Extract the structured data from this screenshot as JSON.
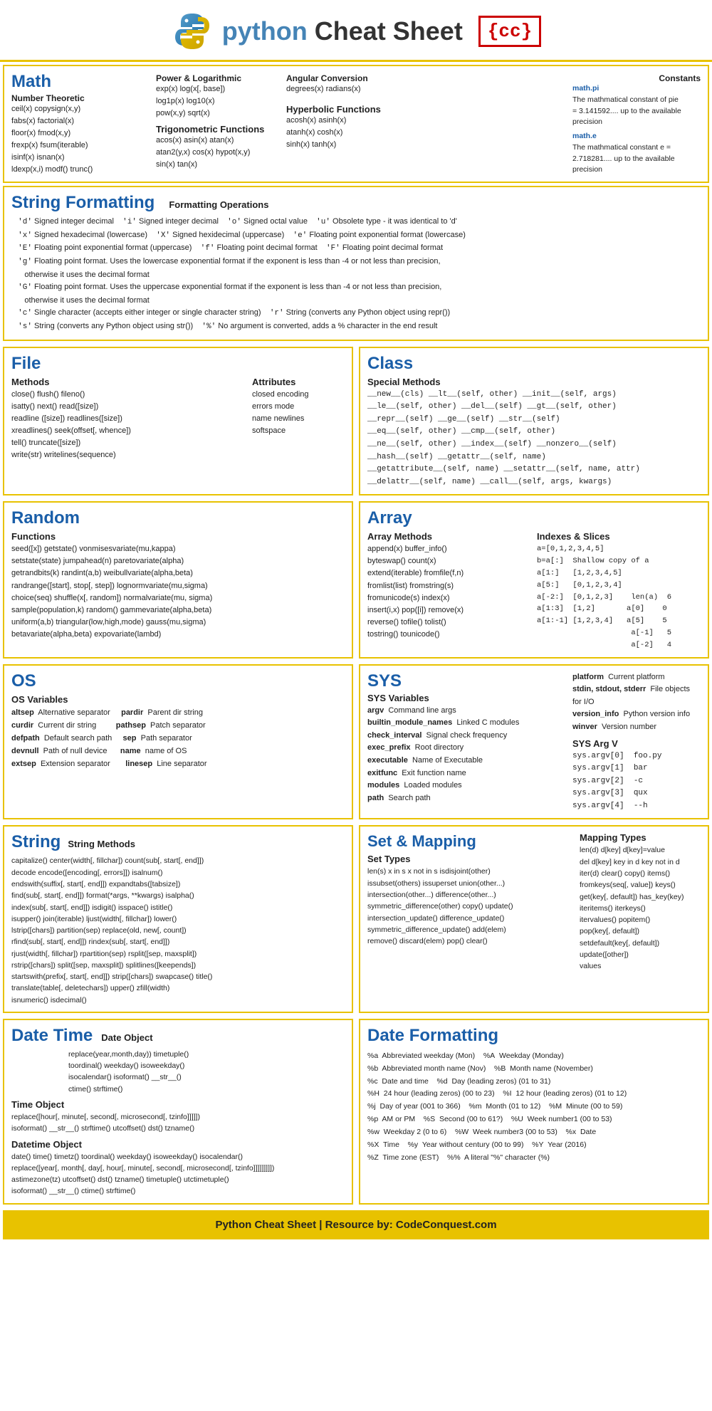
{
  "header": {
    "title": "python Cheat Sheet",
    "python_part": "python",
    "cc_logo": "{cc}"
  },
  "math": {
    "title": "Math",
    "number_theoretic_title": "Number Theoretic",
    "number_theoretic": "ceil(x)  copysign(x,y)\nfabs(x)  factorial(x)\nfloor(x)  fmod(x,y)\nfrexp(x)  fsum(iterable)\nisinf(x)  isnan(x)\nldexp(x,i)  modf()  trunc()",
    "power_log_title": "Power & Logarithmic",
    "power_log": "exp(x)  log(x[, base])\nlog1p(x)  log10(x)\npow(x,y)  sqrt(x)",
    "trig_title": "Trigonometric Functions",
    "trig": "acos(x)  asin(x)  atan(x)\natan2(y,x)  cos(x)  hypot(x,y)\nsin(x)  tan(x)",
    "angular_title": "Angular Conversion",
    "angular": "degrees(x)  radians(x)",
    "hyperbolic_title": "Hyperbolic Functions",
    "hyperbolic": "acosh(x)  asinh(x)\natanh(x)  cosh(x)\nsinh(x)  tanh(x)",
    "constants_title": "Constants",
    "constants": "math.pi\nThe mathmatical constant of pie\n= 3.141592.... up to the available\nprecision\nmath.e\nThe mathmatical constant e =\n2.718281.... up to the available\nprecision"
  },
  "string_formatting": {
    "title": "String Formatting",
    "ops_title": "Formatting Operations",
    "lines": [
      "'d' Signed integer decimal    'i' Signed integer decimal    'o' Signed octal value    'u' Obsolete type - it was identical to 'd'",
      "'x' Signed hexadecimal (lowercase)    'X' Signed hexidecimal (uppercase)    'e' Floating point exponential format (lowercase)",
      "'E' Floating point exponential format (uppercase)    'f' Floating point decimal format    'F' Floating point decimal format",
      "'g' Floating point format. Uses the lowercase exponential format if the exponent is less than -4 or not less than precision, otherwise it uses the decimal format",
      "'G' Floating point format. Uses the uppercase exponential format if the exponent is less than -4 or not less than precision, otherwise it uses the decimal format",
      "'c' Single character (accepts either integer or single character string)    'r' String (converts any Python object using repr())",
      "'s' String (converts any Python object using str())    '%' No argument is converted, adds a % character in the end result"
    ]
  },
  "file": {
    "title": "File",
    "methods_title": "Methods",
    "methods": "close()  flush()  fileno()\nisatty()  next()  read([size])\nreadline ([size])  readlines([size])\nxreadlines()  seek(offset[, whence])\ntell()  truncate([size])\nwrite(str)  writelines(sequence)",
    "attributes_title": "Attributes",
    "attributes": "closed  encoding\nerrors  mode\nname  newlines\nsoftspace"
  },
  "class": {
    "title": "Class",
    "special_methods_title": "Special Methods",
    "special_methods": "__new__(cls)  __lt__(self, other)  __init__(self, args)\n__le__(self, other)  __del__(self)  __gt__(self, other)\n__repr__(self)  __ge__(self)  __str__(self)\n__eq__(self, other)  __cmp__(self, other)\n__ne__(self, other)  __index__(self)  __nonzero__(self)\n__hash__(self)  __getattr__(self, name)\n__getattribute__(self, name)  __setattr__(self, name, attr)\n__delattr__(self, name)  __call__(self, args, kwargs)"
  },
  "random": {
    "title": "Random",
    "functions_title": "Functions",
    "functions": "seed([x])  getstate()  vonmisesvariate(mu,kappa)\nsetstate(state)  jumpahead(n)  paretovariate(alpha)\ngetrandbits(k)  randint(a,b)  weibullvariate(alpha,beta)\nrandrange([start], stop[, step])  lognormvariate(mu,sigma)\nchoice(seq)  shuffle(x[, random])  normalvariate(mu, sigma)\nsample(population,k)  random()  gammevariate(alpha,beta)\nuniform(a,b)  triangular(low,high,mode)  gauss(mu,sigma)\nbetavariate(alpha,beta)  expovariate(lambd)"
  },
  "array": {
    "title": "Array",
    "methods_title": "Array Methods",
    "methods": "append(x)  buffer_info()\nbyteswap()  count(x)\nextend(iterable)  fromfile(f,n)\nfromlist(list)  fromstring(s)\nfromunicode(s)  index(x)\ninsert(i,x)  pop([i])  remove(x)\nreverse()  tofile()  tolist()\ntostring()  tounicode()",
    "indexes_title": "Indexes & Slices",
    "indexes": "a=[0,1,2,3,4,5]\nb=a[:]  Shallow copy of a\na[1:]   [1,2,3,4,5]\na[5:]   [0,1,2,3,4]\na[-2:]  [0,1,2,3]    len(a)  6\na[1:3]  [1,2]        a[0]    0\na[1:-1] [1,2,3,4]    a[5]    5\n                     a[-1]   5\n                     a[-2]   4"
  },
  "os": {
    "title": "OS",
    "variables_title": "OS Variables",
    "variables": "altsep  Alternative separator    pardir  Parent dir string\ncurdir  Current dir string        pathsep  Patch separator\ndefpath  Default search path      sep  Path separator\ndevnull  Path of null device      name  name of OS\nextsep  Extension separator       linesep  Line separator"
  },
  "sys": {
    "title": "SYS",
    "platform": "platform  Current platform\nstdin, stdout, stderr  File objects for I/O\nversion_info  Python version info\nwinver  Version number",
    "variables_title": "SYS Variables",
    "variables": "argv  Command line args\nbuiltin_module_names  Linked C modules\ncheck_interval  Signal check frequency\nexec_prefix  Root directory\nexecutable  Name of Executable\nexitfunc  Exit function name\nmodules  Loaded modules\npath  Search path",
    "arg_v_title": "SYS Arg V",
    "arg_v": "sys.argv[0]  foo.py\nsys.argv[1]  bar\nsys.argv[2]  -c\nsys.argv[3]  qux\nsys.argv[4]  --h"
  },
  "string": {
    "title": "String",
    "methods_title": "String Methods",
    "methods": "capitalize()  center(width[, fillchar])  count(sub[, start[, end]])\ndecode  encode([encoding[, errors]])  isalnum()\nendswith(suffix[, start[, end]])  expandtabs([tabsize])\nfind(sub[, start[, end]])  format(*args, **kwargs)  isalpha()\nindex(sub[, start[, end]])  isdigit()  isspace()  istitle()\nisupper()  join(iterable)  ljust(width[, fillchar])  lower()\nlstrip([chars])  partition(sep)  replace(old, new[, count])\nrfind(sub[, start[, end]])  rindex(sub[, start[, end]])\nrjust(width[, fillchar])  rpartition(sep)  rsplit([sep, maxsplit])\nrstrip([chars])  split([sep, maxsplit])  splitlines([keepends])\nstartswith(prefix[, start[, end]])  strip([chars])  swapcase()  title()\ntranslate(table[, deletechars])  upper()  zfill(width)\nisnumeric()  isdecimal()"
  },
  "set_mapping": {
    "title": "Set & Mapping",
    "mapping_title": "Mapping Types",
    "mapping": "len(d)  d[key]  d[key]=value\ndel d[key]  key in d  key not in d\niter(d)  clear()  copy()  items()\nfromkeys(seq[, value])  keys()\nget(key[, default])  has_key(key)\niteritems()  iterkeys()\nitervalues()  popitem()\npop(key[, default])\nsetdefault(key[, default])\nupdate([other])\nvalues",
    "set_types_title": "Set Types",
    "set_types": "len(s)  x in s  x not in s  isdisjoint(other)\nissubset(others)  issuperset  union(other...)\nintersection(other...)  difference(other...)\nsymmetric_difference(other)  copy()  update()\nintersection_update()  difference_update()\nsymmetric_difference_update()  add(elem)\nremove()  discard(elem)  pop()  clear()"
  },
  "date_time": {
    "title": "Date Time",
    "date_object_title": "Date Object",
    "date_object": "replace(year,month,day))  timetuple()\ntoordinal()  weekday()  isoweekday()\nisocalendar()  isoformat()  __str__()\nctime()  strftime()",
    "time_object_title": "Time Object",
    "time_object": "replace([hour[, minute[, second[, microsecond[, tzinfo]]]]])\nisoformat()  __str__()  strftime()  utcoffset()  dst()  tzname()",
    "datetime_object_title": "Datetime Object",
    "datetime_object": "date()  time()  timetz()  toordinal()  weekday()  isoweekday()  isocalendar()\nreplace([year[, month[, day[, hour[, minute[, second[, microsecond[, tzinfo]]]]]]]]])\nastimezone(tz)  utcoffset()  dst()  tzname()  timetuple()  utctimetuple()\nisoformat()  __str__()  ctime()  strftime()"
  },
  "date_formatting": {
    "title": "Date Formatting",
    "lines": [
      "%a  Abbreviated weekday (Mon)    %A  Weekday (Monday)",
      "%b  Abbreviated month name (Nov)    %B  Month name (November)",
      "%c  Date and time    %d  Day (leading zeros) (01 to 31)",
      "%H  24 hour (leading zeros) (00 to 23)    %I  12 hour (leading zeros) (01 to 12)",
      "%j  Day of year (001 to 366)    %m  Month (01 to 12)    %M  Minute (00 to 59)",
      "%p  AM or PM    %S  Second (00 to 61?)    %U  Week number1 (00 to 53)",
      "%w  Weekday 2 (0 to 6)    %W  Week number3 (00 to 53)    %x  Date",
      "%X  Time    %y  Year without century (00 to 99)    %Y  Year (2016)",
      "%Z  Time zone (EST)    %%  A literal \"%\" character (%)"
    ]
  },
  "footer": {
    "text": "Python Cheat Sheet | Resource by: CodeConquest.com"
  }
}
